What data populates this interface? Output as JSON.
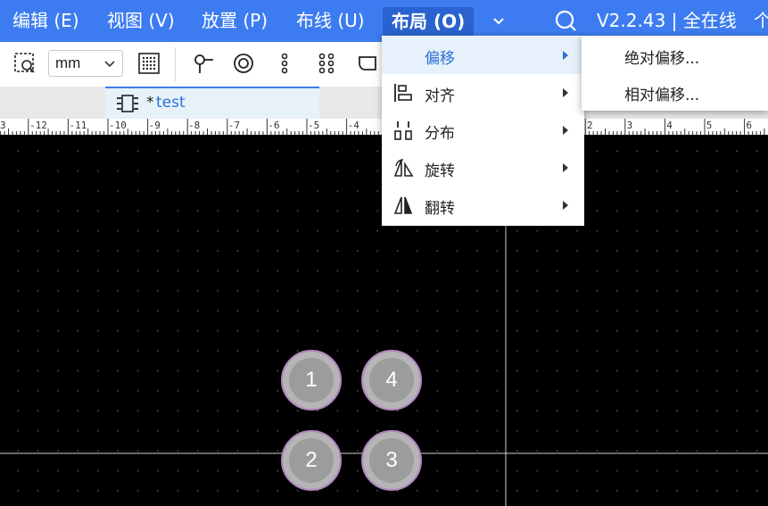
{
  "menubar": {
    "edit": "编辑 (E)",
    "view": "视图 (V)",
    "place": "放置 (P)",
    "route": "布线 (U)",
    "layout": "布局 (O)",
    "version": "V2.2.43 | 全在线",
    "overflow": "个"
  },
  "toolbar": {
    "unit": "mm"
  },
  "tab": {
    "modified_mark": "*",
    "name": "test"
  },
  "ruler": {
    "ticks_left": [
      "3",
      "-12",
      "-11",
      "-10",
      "-9",
      "-8",
      "-7",
      "-6",
      "-5",
      "-4"
    ],
    "ticks_right": [
      "2",
      "3",
      "4",
      "5",
      "6"
    ]
  },
  "layout_menu": {
    "items": [
      {
        "label": "偏移",
        "icon": "offset-icon"
      },
      {
        "label": "对齐",
        "icon": "align-icon"
      },
      {
        "label": "分布",
        "icon": "distribute-icon"
      },
      {
        "label": "旋转",
        "icon": "rotate-icon"
      },
      {
        "label": "翻转",
        "icon": "flip-icon"
      }
    ]
  },
  "offset_submenu": {
    "items": [
      "绝对偏移...",
      "相对偏移..."
    ]
  },
  "pads": [
    "1",
    "4",
    "2",
    "3"
  ],
  "colors": {
    "menubar": "#3d7cf0",
    "accent": "#2d6fd6",
    "canvas": "#000000",
    "pad_outline": "#b584c4"
  }
}
